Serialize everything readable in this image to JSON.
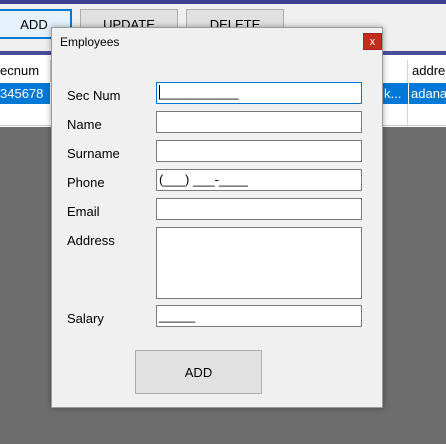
{
  "main": {
    "buttons": {
      "add": "ADD",
      "update": "UPDATE",
      "delete": "DELETE"
    },
    "grid": {
      "headers": [
        "ecnum",
        "addre"
      ],
      "selected_row": {
        "secnum": "345678",
        "mid": "k...",
        "address": "adana"
      }
    }
  },
  "dialog": {
    "title": "Employees",
    "close_glyph": "x",
    "labels": {
      "secnum": "Sec Num",
      "name": "Name",
      "surname": "Surname",
      "phone": "Phone",
      "email": "Email",
      "address": "Address",
      "salary": "Salary"
    },
    "fields": {
      "secnum_mask": "___________",
      "name": "",
      "surname": "",
      "phone_mask": "(___) ___-____",
      "email": "",
      "address": "",
      "salary_mask": "_____"
    },
    "add_button": "ADD"
  }
}
